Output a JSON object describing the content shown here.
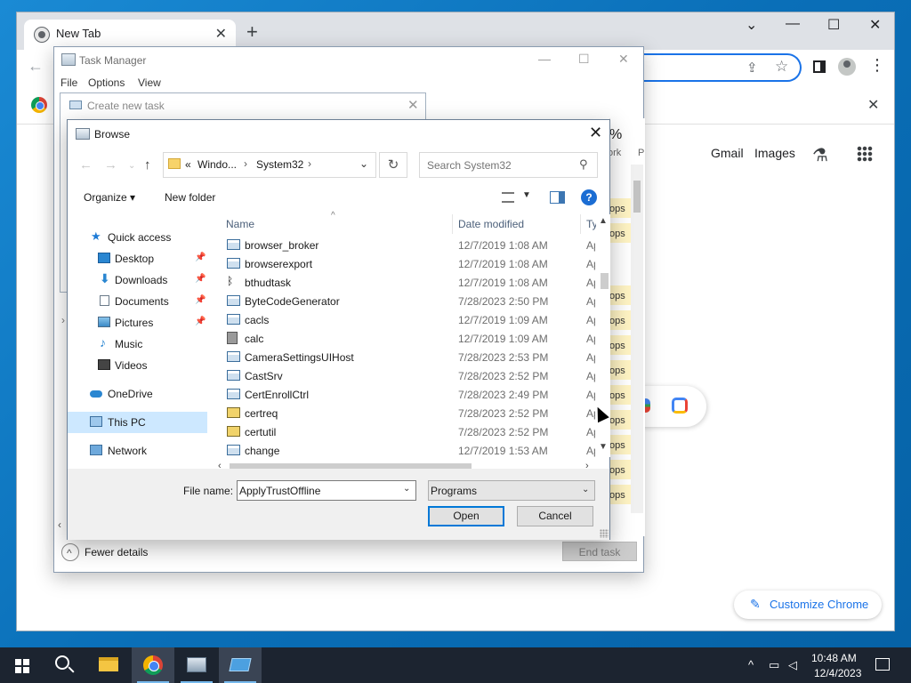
{
  "chrome": {
    "tab_title": "New Tab",
    "ntp_links": [
      "Gmail",
      "Images"
    ],
    "customize_label": "Customize Chrome"
  },
  "taskmgr": {
    "title": "Task Manager",
    "menu": [
      "File",
      "Options",
      "View"
    ],
    "col_pct": "%",
    "col_work": "ork",
    "col_p": "P",
    "apps_text": "ops",
    "fewer_details": "Fewer details",
    "end_task": "End task"
  },
  "create_task": {
    "title": "Create new task"
  },
  "browse": {
    "title": "Browse",
    "address": {
      "prefix": "«",
      "crumbs": [
        "Windo...",
        "System32"
      ]
    },
    "search_placeholder": "Search System32",
    "toolbar": {
      "organize": "Organize ▾",
      "new_folder": "New folder",
      "help": "?"
    },
    "nav": [
      {
        "label": "Quick access",
        "icon": "star-icon",
        "indent": 0,
        "pinned": false
      },
      {
        "label": "Desktop",
        "icon": "desktop-folder-icon",
        "indent": 1,
        "pinned": true
      },
      {
        "label": "Downloads",
        "icon": "download-arrow-icon",
        "indent": 1,
        "pinned": true
      },
      {
        "label": "Documents",
        "icon": "document-icon",
        "indent": 1,
        "pinned": true
      },
      {
        "label": "Pictures",
        "icon": "pictures-icon",
        "indent": 1,
        "pinned": true
      },
      {
        "label": "Music",
        "icon": "music-note-icon",
        "indent": 1,
        "pinned": false
      },
      {
        "label": "Videos",
        "icon": "video-icon",
        "indent": 1,
        "pinned": false
      },
      {
        "label": "OneDrive",
        "icon": "cloud-icon",
        "indent": 0,
        "pinned": false
      },
      {
        "label": "This PC",
        "icon": "computer-icon",
        "indent": 0,
        "pinned": false,
        "selected": true
      },
      {
        "label": "Network",
        "icon": "network-icon",
        "indent": 0,
        "pinned": false
      }
    ],
    "columns": {
      "name": "Name",
      "date": "Date modified",
      "type": "Ty"
    },
    "files": [
      {
        "name": "browser_broker",
        "date": "12/7/2019 1:08 AM",
        "type": "Ap"
      },
      {
        "name": "browserexport",
        "date": "12/7/2019 1:08 AM",
        "type": "Ap"
      },
      {
        "name": "bthudtask",
        "date": "12/7/2019 1:08 AM",
        "type": "Ap"
      },
      {
        "name": "ByteCodeGenerator",
        "date": "7/28/2023 2:50 PM",
        "type": "Ap"
      },
      {
        "name": "cacls",
        "date": "12/7/2019 1:09 AM",
        "type": "Ap"
      },
      {
        "name": "calc",
        "date": "12/7/2019 1:09 AM",
        "type": "Ap"
      },
      {
        "name": "CameraSettingsUIHost",
        "date": "7/28/2023 2:53 PM",
        "type": "Ap"
      },
      {
        "name": "CastSrv",
        "date": "7/28/2023 2:52 PM",
        "type": "Ap"
      },
      {
        "name": "CertEnrollCtrl",
        "date": "7/28/2023 2:49 PM",
        "type": "Ap"
      },
      {
        "name": "certreq",
        "date": "7/28/2023 2:52 PM",
        "type": "Ap"
      },
      {
        "name": "certutil",
        "date": "7/28/2023 2:52 PM",
        "type": "Ap"
      },
      {
        "name": "change",
        "date": "12/7/2019 1:53 AM",
        "type": "Ap"
      }
    ],
    "filename_label": "File name:",
    "filename_value": "ApplyTrustOffline",
    "filetype_value": "Programs",
    "open_label": "Open",
    "cancel_label": "Cancel"
  },
  "taskbar": {
    "time": "10:48 AM",
    "date": "12/4/2023"
  }
}
